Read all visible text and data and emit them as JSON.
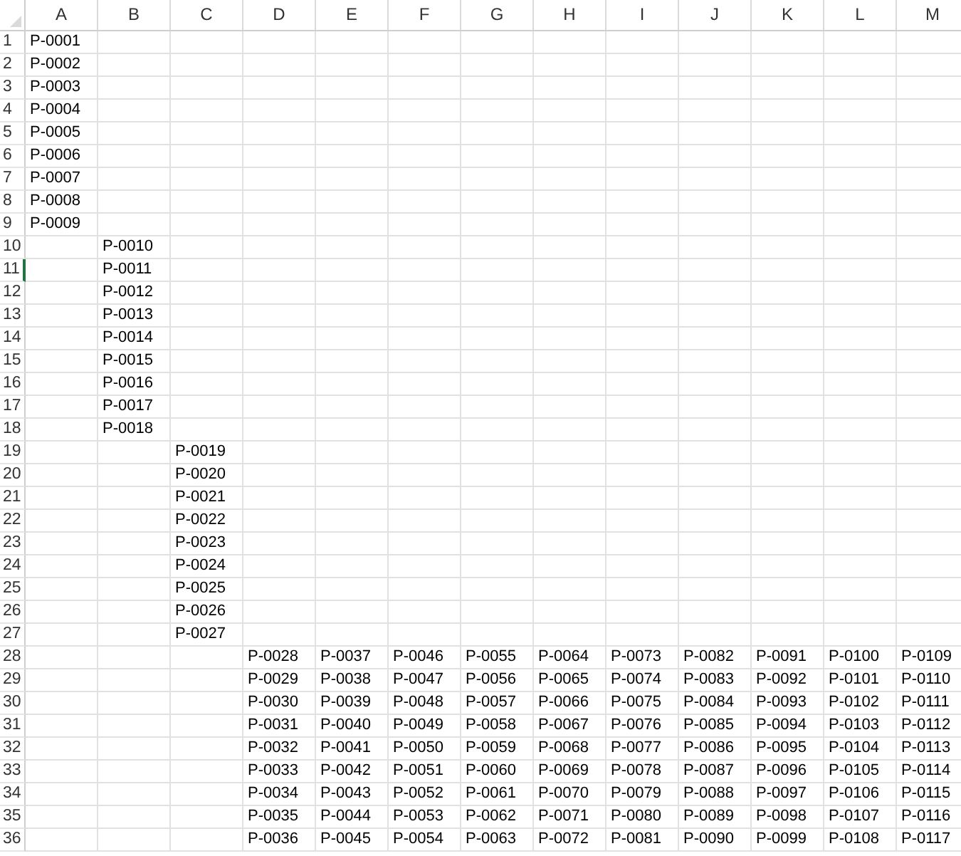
{
  "columns": [
    {
      "label": "A"
    },
    {
      "label": "B"
    },
    {
      "label": "C"
    },
    {
      "label": "D"
    },
    {
      "label": "E"
    },
    {
      "label": "F"
    },
    {
      "label": "G"
    },
    {
      "label": "H"
    },
    {
      "label": "I"
    },
    {
      "label": "J"
    },
    {
      "label": "K"
    },
    {
      "label": "L"
    },
    {
      "label": "M"
    }
  ],
  "rows": [
    {
      "number": "1",
      "selected": false,
      "cells": [
        "P-0001"
      ]
    },
    {
      "number": "2",
      "selected": false,
      "cells": [
        "P-0002"
      ]
    },
    {
      "number": "3",
      "selected": false,
      "cells": [
        "P-0003"
      ]
    },
    {
      "number": "4",
      "selected": false,
      "cells": [
        "P-0004"
      ]
    },
    {
      "number": "5",
      "selected": false,
      "cells": [
        "P-0005"
      ]
    },
    {
      "number": "6",
      "selected": false,
      "cells": [
        "P-0006"
      ]
    },
    {
      "number": "7",
      "selected": false,
      "cells": [
        "P-0007"
      ]
    },
    {
      "number": "8",
      "selected": false,
      "cells": [
        "P-0008"
      ]
    },
    {
      "number": "9",
      "selected": false,
      "cells": [
        "P-0009"
      ]
    },
    {
      "number": "10",
      "selected": false,
      "cells": [
        null,
        "P-0010"
      ]
    },
    {
      "number": "11",
      "selected": true,
      "cells": [
        null,
        "P-0011"
      ]
    },
    {
      "number": "12",
      "selected": false,
      "cells": [
        null,
        "P-0012"
      ]
    },
    {
      "number": "13",
      "selected": false,
      "cells": [
        null,
        "P-0013"
      ]
    },
    {
      "number": "14",
      "selected": false,
      "cells": [
        null,
        "P-0014"
      ]
    },
    {
      "number": "15",
      "selected": false,
      "cells": [
        null,
        "P-0015"
      ]
    },
    {
      "number": "16",
      "selected": false,
      "cells": [
        null,
        "P-0016"
      ]
    },
    {
      "number": "17",
      "selected": false,
      "cells": [
        null,
        "P-0017"
      ]
    },
    {
      "number": "18",
      "selected": false,
      "cells": [
        null,
        "P-0018"
      ]
    },
    {
      "number": "19",
      "selected": false,
      "cells": [
        null,
        null,
        "P-0019"
      ]
    },
    {
      "number": "20",
      "selected": false,
      "cells": [
        null,
        null,
        "P-0020"
      ]
    },
    {
      "number": "21",
      "selected": false,
      "cells": [
        null,
        null,
        "P-0021"
      ]
    },
    {
      "number": "22",
      "selected": false,
      "cells": [
        null,
        null,
        "P-0022"
      ]
    },
    {
      "number": "23",
      "selected": false,
      "cells": [
        null,
        null,
        "P-0023"
      ]
    },
    {
      "number": "24",
      "selected": false,
      "cells": [
        null,
        null,
        "P-0024"
      ]
    },
    {
      "number": "25",
      "selected": false,
      "cells": [
        null,
        null,
        "P-0025"
      ]
    },
    {
      "number": "26",
      "selected": false,
      "cells": [
        null,
        null,
        "P-0026"
      ]
    },
    {
      "number": "27",
      "selected": false,
      "cells": [
        null,
        null,
        "P-0027"
      ]
    },
    {
      "number": "28",
      "selected": false,
      "cells": [
        null,
        null,
        null,
        "P-0028",
        "P-0037",
        "P-0046",
        "P-0055",
        "P-0064",
        "P-0073",
        "P-0082",
        "P-0091",
        "P-0100",
        "P-0109"
      ]
    },
    {
      "number": "29",
      "selected": false,
      "cells": [
        null,
        null,
        null,
        "P-0029",
        "P-0038",
        "P-0047",
        "P-0056",
        "P-0065",
        "P-0074",
        "P-0083",
        "P-0092",
        "P-0101",
        "P-0110"
      ]
    },
    {
      "number": "30",
      "selected": false,
      "cells": [
        null,
        null,
        null,
        "P-0030",
        "P-0039",
        "P-0048",
        "P-0057",
        "P-0066",
        "P-0075",
        "P-0084",
        "P-0093",
        "P-0102",
        "P-0111"
      ]
    },
    {
      "number": "31",
      "selected": false,
      "cells": [
        null,
        null,
        null,
        "P-0031",
        "P-0040",
        "P-0049",
        "P-0058",
        "P-0067",
        "P-0076",
        "P-0085",
        "P-0094",
        "P-0103",
        "P-0112"
      ]
    },
    {
      "number": "32",
      "selected": false,
      "cells": [
        null,
        null,
        null,
        "P-0032",
        "P-0041",
        "P-0050",
        "P-0059",
        "P-0068",
        "P-0077",
        "P-0086",
        "P-0095",
        "P-0104",
        "P-0113"
      ]
    },
    {
      "number": "33",
      "selected": false,
      "cells": [
        null,
        null,
        null,
        "P-0033",
        "P-0042",
        "P-0051",
        "P-0060",
        "P-0069",
        "P-0078",
        "P-0087",
        "P-0096",
        "P-0105",
        "P-0114"
      ]
    },
    {
      "number": "34",
      "selected": false,
      "cells": [
        null,
        null,
        null,
        "P-0034",
        "P-0043",
        "P-0052",
        "P-0061",
        "P-0070",
        "P-0079",
        "P-0088",
        "P-0097",
        "P-0106",
        "P-0115"
      ]
    },
    {
      "number": "35",
      "selected": false,
      "cells": [
        null,
        null,
        null,
        "P-0035",
        "P-0044",
        "P-0053",
        "P-0062",
        "P-0071",
        "P-0080",
        "P-0089",
        "P-0098",
        "P-0107",
        "P-0116"
      ]
    },
    {
      "number": "36",
      "selected": false,
      "cells": [
        null,
        null,
        null,
        "P-0036",
        "P-0045",
        "P-0054",
        "P-0063",
        "P-0072",
        "P-0081",
        "P-0090",
        "P-0099",
        "P-0108",
        "P-0117"
      ]
    }
  ]
}
